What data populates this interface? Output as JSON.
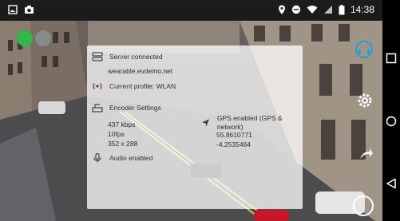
{
  "statusbar": {
    "time": "14:38"
  },
  "panel": {
    "server_status": "Server connected",
    "server_host": "wearable.evdemo.net",
    "profile": "Current profile: WLAN",
    "encoder_title": "Encoder Settings",
    "bitrate": "437 kbps",
    "fps": "10fps",
    "resolution": "352 x 288",
    "gps_status": "GPS enabled (GPS & network)",
    "latitude": "55.8610771",
    "longitude": "-4.2535464",
    "audio_status": "Audio enabled"
  },
  "colors": {
    "record_active": "#2fb84a",
    "record_inactive": "#8a8a8a",
    "accent": "#1da1d6"
  },
  "icons": [
    "image-icon",
    "camera-icon",
    "location-icon",
    "minus-circle-icon",
    "wifi-icon",
    "signal-icon",
    "battery-icon",
    "server-icon",
    "broadcast-icon",
    "encoder-icon",
    "gps-arrow-icon",
    "microphone-icon",
    "headset-icon",
    "settings-gear-icon",
    "share-icon",
    "shutter-icon",
    "recent-apps-icon",
    "home-icon",
    "back-icon"
  ]
}
